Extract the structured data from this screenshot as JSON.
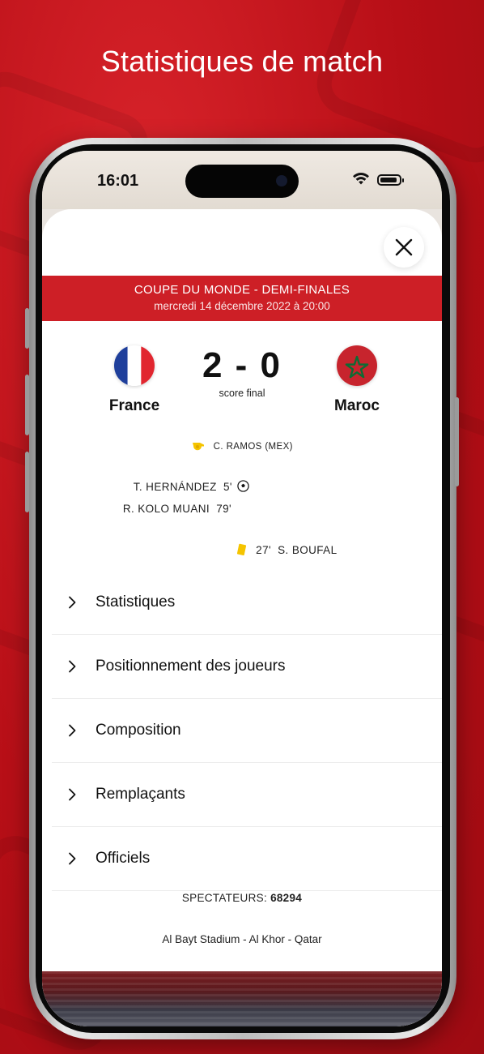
{
  "headline": "Statistiques de match",
  "status_bar": {
    "time": "16:01"
  },
  "match": {
    "competition": "COUPE DU MONDE - DEMI-FINALES",
    "date": "mercredi 14 décembre 2022 à 20:00",
    "home_team": "France",
    "away_team": "Maroc",
    "score": "2 - 0",
    "score_label": "score final",
    "referee": "C. RAMOS (MEX)"
  },
  "events": {
    "home_goals": [
      {
        "player": "T. HERNÁNDEZ",
        "minute": "5'"
      },
      {
        "player": "R. KOLO MUANI",
        "minute": "79'"
      }
    ],
    "away_cards": [
      {
        "minute": "27'",
        "player": "S. BOUFAL"
      }
    ]
  },
  "menu": {
    "items": [
      {
        "label": "Statistiques"
      },
      {
        "label": "Positionnement des joueurs"
      },
      {
        "label": "Composition"
      },
      {
        "label": "Remplaçants"
      },
      {
        "label": "Officiels"
      }
    ]
  },
  "footer": {
    "spectators_label": "SPECTATEURS:",
    "spectators_value": "68294",
    "stadium": "Al Bayt Stadium - Al Khor - Qatar"
  },
  "icons": {
    "close": "close-icon",
    "chevron": "chevron-right-icon",
    "whistle": "whistle-icon",
    "ball": "soccer-ball-icon",
    "card": "yellow-card-icon"
  },
  "colors": {
    "accent": "#cd1f26",
    "background": "#c8111a",
    "yellow_card": "#f5c400"
  }
}
